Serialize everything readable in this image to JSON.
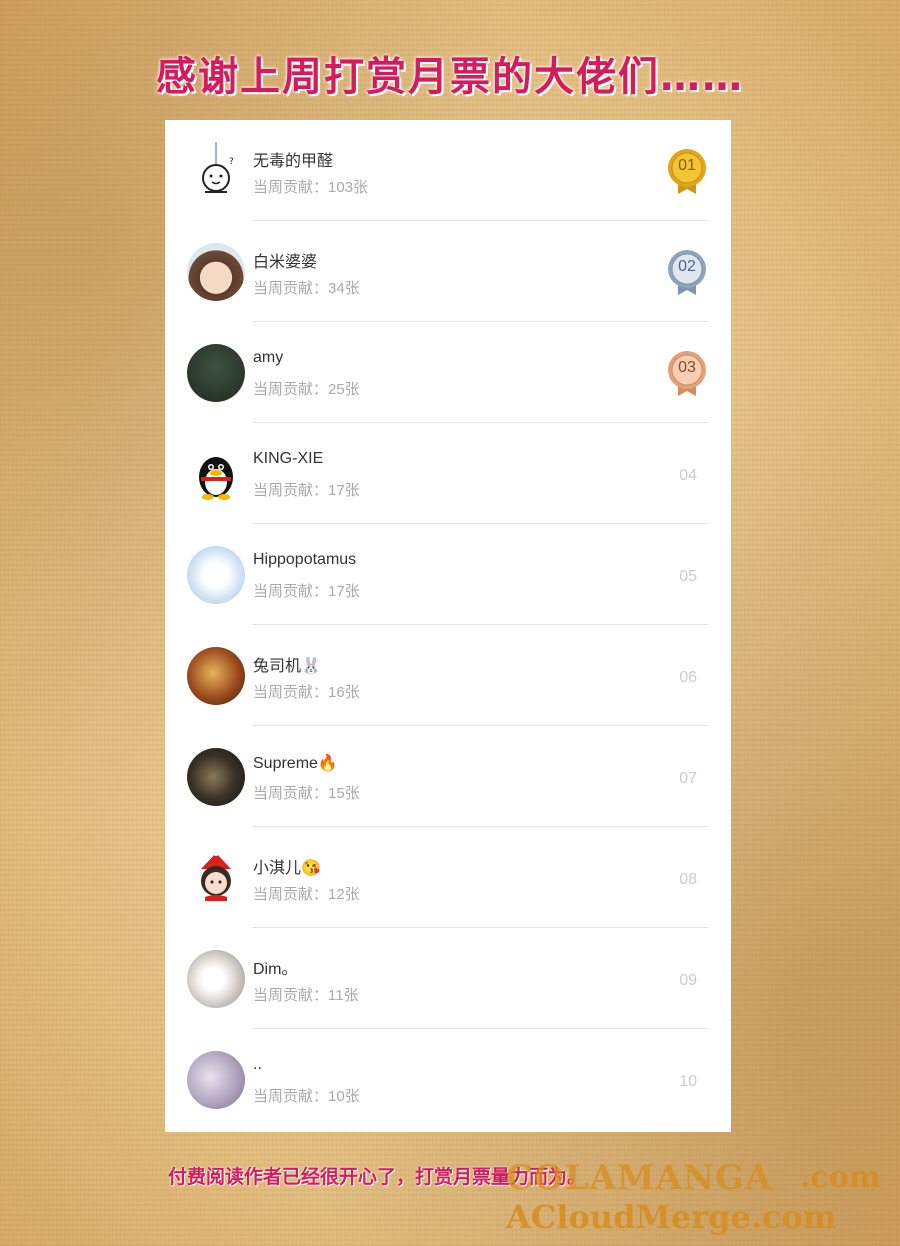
{
  "title": "感谢上周打赏月票的大佬们……",
  "contrib_label": "当周贡献：",
  "entries": [
    {
      "rank": "01",
      "name": "无毒的甲醛",
      "contribution": "103张",
      "medal": "gold"
    },
    {
      "rank": "02",
      "name": "白米婆婆",
      "contribution": "34张",
      "medal": "silver"
    },
    {
      "rank": "03",
      "name": "amy",
      "contribution": "25张",
      "medal": "bronze"
    },
    {
      "rank": "04",
      "name": "KING-XIE",
      "contribution": "17张"
    },
    {
      "rank": "05",
      "name": "Hippopotamus",
      "contribution": "17张"
    },
    {
      "rank": "06",
      "name": "兔司机🐰",
      "contribution": "16张"
    },
    {
      "rank": "07",
      "name": "Supreme🔥",
      "contribution": "15张"
    },
    {
      "rank": "08",
      "name": "小淇儿😘",
      "contribution": "12张"
    },
    {
      "rank": "09",
      "name": "Dim。",
      "contribution": "11张"
    },
    {
      "rank": "10",
      "name": "..",
      "contribution": "10张"
    }
  ],
  "footer": "付费阅读作者已经很开心了，打赏月票量力而为。",
  "watermark": {
    "line1": "COLAMANGA",
    "line1_suffix": ".com",
    "line2": "ACloudMerge.com"
  },
  "colors": {
    "accent": "#d41c5d",
    "gold": "#e2a61c",
    "silver": "#8fa3bd",
    "bronze": "#e4a07a"
  }
}
